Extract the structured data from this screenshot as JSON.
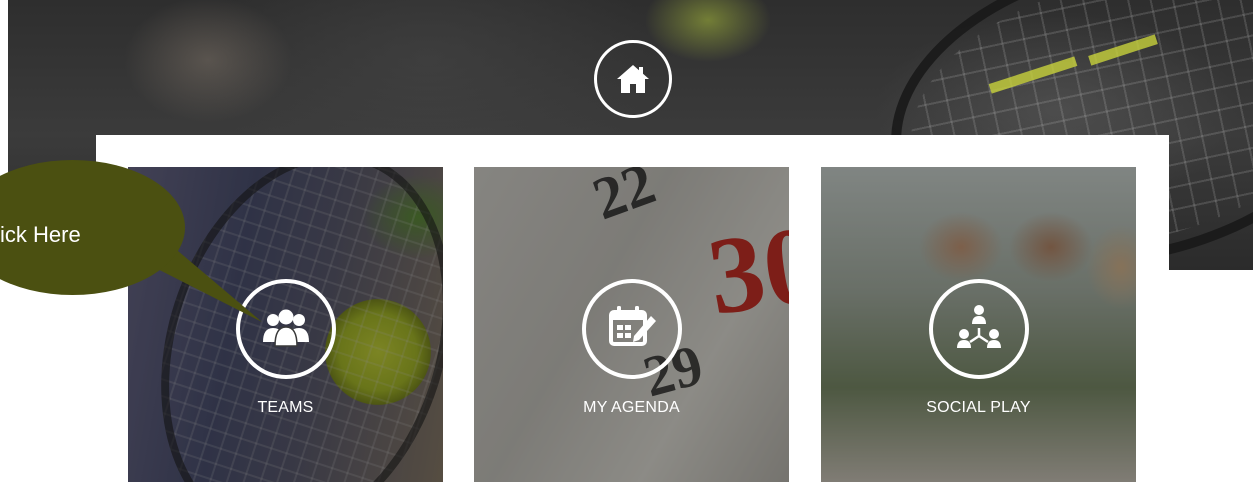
{
  "home": {
    "icon": "home-icon"
  },
  "tiles": [
    {
      "label": "TEAMS",
      "icon": "users-icon"
    },
    {
      "label": "MY AGENDA",
      "icon": "calendar-edit-icon"
    },
    {
      "label": "SOCIAL PLAY",
      "icon": "network-people-icon"
    }
  ],
  "callout": {
    "text": "ick Here",
    "color": "#4b5011"
  },
  "agenda_numbers": [
    "22",
    "30",
    "29"
  ],
  "colors": {
    "overlay_text": "#ffffff",
    "panel": "#ffffff"
  }
}
